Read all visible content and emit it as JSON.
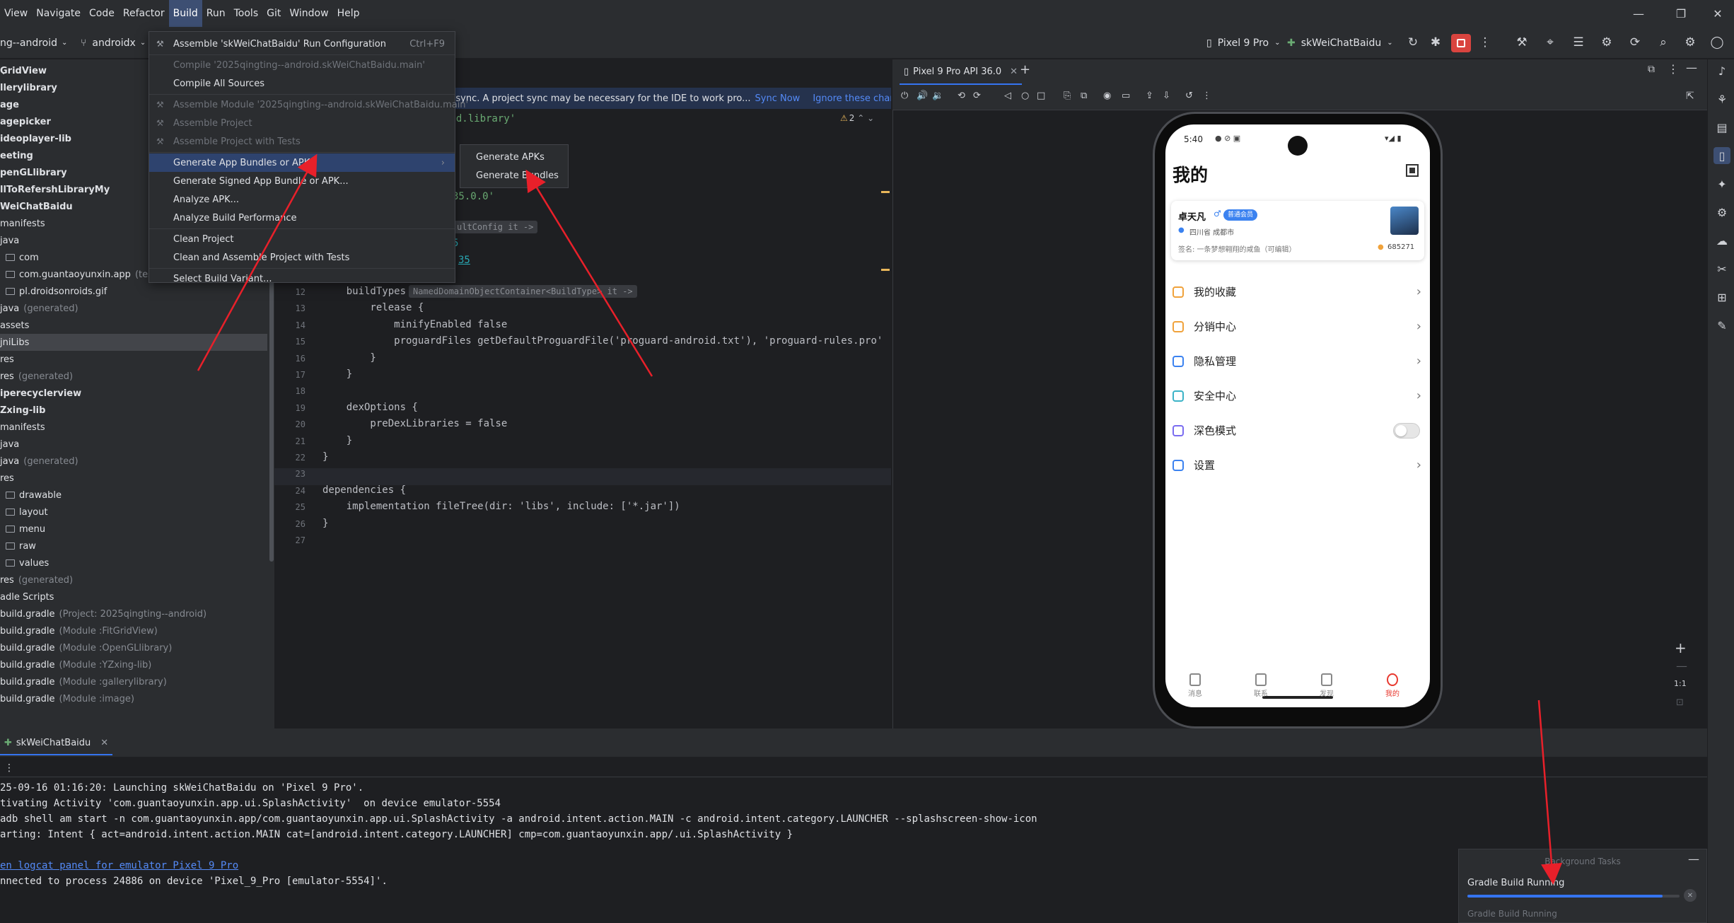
{
  "menubar": {
    "items": [
      "View",
      "Navigate",
      "Code",
      "Refactor",
      "Build",
      "Run",
      "Tools",
      "Git",
      "Window",
      "Help"
    ],
    "active": "Build"
  },
  "toolbar": {
    "project_name": "ng--android",
    "branch": "androidx",
    "device": "Pixel 9 Pro",
    "run_config": "skWeiChatBaidu"
  },
  "tree": {
    "items": [
      {
        "label": "GridView",
        "bold": true,
        "hint": "",
        "indent": 0
      },
      {
        "label": "llerylibrary",
        "bold": true,
        "hint": "",
        "indent": 0
      },
      {
        "label": "age",
        "bold": true,
        "hint": "",
        "indent": 0
      },
      {
        "label": "agepicker",
        "bold": true,
        "hint": "",
        "indent": 0
      },
      {
        "label": "ideoplayer-lib",
        "bold": true,
        "hint": "",
        "indent": 0
      },
      {
        "label": "eeting",
        "bold": true,
        "hint": "",
        "indent": 0
      },
      {
        "label": "penGLlibrary",
        "bold": true,
        "hint": "",
        "indent": 0
      },
      {
        "label": "llToRefershLibraryMy",
        "bold": true,
        "hint": "",
        "indent": 0
      },
      {
        "label": "WeiChatBaidu",
        "bold": true,
        "hint": "",
        "indent": 0
      },
      {
        "label": "manifests",
        "bold": false,
        "hint": "",
        "indent": 0
      },
      {
        "label": "java",
        "bold": false,
        "hint": "",
        "indent": 0
      },
      {
        "label": "com",
        "bold": false,
        "hint": "",
        "indent": 1
      },
      {
        "label": "com.guantaoyunxin.app",
        "bold": false,
        "hint": "(test)",
        "indent": 1
      },
      {
        "label": "pl.droidsonroids.gif",
        "bold": false,
        "hint": "",
        "indent": 1
      },
      {
        "label": "java",
        "bold": false,
        "hint": "(generated)",
        "indent": 0
      },
      {
        "label": "assets",
        "bold": false,
        "hint": "",
        "indent": 0
      },
      {
        "label": "jniLibs",
        "bold": false,
        "hint": "",
        "indent": 0
      },
      {
        "label": "res",
        "bold": false,
        "hint": "",
        "indent": 0
      },
      {
        "label": "res",
        "bold": false,
        "hint": "(generated)",
        "indent": 0
      },
      {
        "label": "iperecyclerview",
        "bold": true,
        "hint": "",
        "indent": 0
      },
      {
        "label": "Zxing-lib",
        "bold": true,
        "hint": "",
        "indent": 0
      },
      {
        "label": "manifests",
        "bold": false,
        "hint": "",
        "indent": 0
      },
      {
        "label": "java",
        "bold": false,
        "hint": "",
        "indent": 0
      },
      {
        "label": "java",
        "bold": false,
        "hint": "(generated)",
        "indent": 0
      },
      {
        "label": "res",
        "bold": false,
        "hint": "",
        "indent": 0
      },
      {
        "label": "drawable",
        "bold": false,
        "hint": "",
        "indent": 1
      },
      {
        "label": "layout",
        "bold": false,
        "hint": "",
        "indent": 1
      },
      {
        "label": "menu",
        "bold": false,
        "hint": "",
        "indent": 1
      },
      {
        "label": "raw",
        "bold": false,
        "hint": "",
        "indent": 1
      },
      {
        "label": "values",
        "bold": false,
        "hint": "",
        "indent": 1
      },
      {
        "label": "res",
        "bold": false,
        "hint": "(generated)",
        "indent": 0
      },
      {
        "label": "adle Scripts",
        "bold": false,
        "hint": "",
        "indent": 0
      },
      {
        "label": "build.gradle",
        "bold": false,
        "hint": "(Project: 2025qingting--android)",
        "indent": 0
      },
      {
        "label": "build.gradle",
        "bold": false,
        "hint": "(Module :FitGridView)",
        "indent": 0
      },
      {
        "label": "build.gradle",
        "bold": false,
        "hint": "(Module :OpenGLlibrary)",
        "indent": 0
      },
      {
        "label": "build.gradle",
        "bold": false,
        "hint": "(Module :YZxing-lib)",
        "indent": 0
      },
      {
        "label": "build.gradle",
        "bold": false,
        "hint": "(Module :gallerylibrary)",
        "indent": 0
      },
      {
        "label": "build.gradle",
        "bold": false,
        "hint": "(Module :image)",
        "indent": 0
      }
    ]
  },
  "banner": {
    "text": "ect sync. A project sync may be necessary for the IDE to work pro...",
    "sync_now": "Sync Now",
    "ignore": "Ignore these changes"
  },
  "editor": {
    "warnings": "2",
    "fragments": {
      "plugin": "oid.library'",
      "version": "35.0.0'",
      "inlay_default": "ultConfig it ->",
      "n35": "35",
      "s5": "5"
    },
    "build_types_inlay": "NamedDomainObjectContainer<BuildType> it ->",
    "lines": [
      {
        "n": "12",
        "text": "    buildTypes {"
      },
      {
        "n": "13",
        "text": "        release {"
      },
      {
        "n": "14",
        "text": "            minifyEnabled false"
      },
      {
        "n": "15",
        "text": "            proguardFiles getDefaultProguardFile('proguard-android.txt'), 'proguard-rules.pro'"
      },
      {
        "n": "16",
        "text": "        }"
      },
      {
        "n": "17",
        "text": "    }"
      },
      {
        "n": "18",
        "text": ""
      },
      {
        "n": "19",
        "text": "    dexOptions {"
      },
      {
        "n": "20",
        "text": "        preDexLibraries = false"
      },
      {
        "n": "21",
        "text": "    }"
      },
      {
        "n": "22",
        "text": "}"
      },
      {
        "n": "23",
        "text": ""
      },
      {
        "n": "24",
        "text": "dependencies {"
      },
      {
        "n": "25",
        "text": "    implementation fileTree(dir: 'libs', include: ['*.jar'])"
      },
      {
        "n": "26",
        "text": "}"
      },
      {
        "n": "27",
        "text": ""
      }
    ]
  },
  "build_menu": {
    "items": [
      {
        "label": "Assemble 'skWeiChatBaidu' Run Configuration",
        "shortcut": "Ctrl+F9",
        "disabled": false
      },
      {
        "label": "Compile '2025qingting--android.skWeiChatBaidu.main'",
        "shortcut": "",
        "disabled": true
      },
      {
        "label": "Compile All Sources",
        "shortcut": "",
        "disabled": false
      },
      {
        "label": "Assemble Module '2025qingting--android.skWeiChatBaidu.main'",
        "shortcut": "",
        "disabled": true
      },
      {
        "label": "Assemble Project",
        "shortcut": "",
        "disabled": true
      },
      {
        "label": "Assemble Project with Tests",
        "shortcut": "",
        "disabled": true
      },
      {
        "label": "Generate App Bundles or APKs",
        "shortcut": "",
        "disabled": false
      },
      {
        "label": "Generate Signed App Bundle or APK...",
        "shortcut": "",
        "disabled": false
      },
      {
        "label": "Analyze APK...",
        "shortcut": "",
        "disabled": false
      },
      {
        "label": "Analyze Build Performance",
        "shortcut": "",
        "disabled": false
      },
      {
        "label": "Clean Project",
        "shortcut": "",
        "disabled": false
      },
      {
        "label": "Clean and Assemble Project with Tests",
        "shortcut": "",
        "disabled": false
      },
      {
        "label": "Select Build Variant...",
        "shortcut": "",
        "disabled": false
      }
    ],
    "highlighted": "Generate App Bundles or APKs",
    "submenu": [
      "Generate APKs",
      "Generate Bundles"
    ]
  },
  "emulator": {
    "tab_title": "Pixel 9 Pro API 36.0",
    "zoom_label": "1:1"
  },
  "phone": {
    "status_time": "5:40",
    "title": "我的",
    "user_name": "卓天凡",
    "badge": "普通会员",
    "location": "四川省 成都市",
    "signature": "签名: 一条梦想翱翔的咸鱼（可编辑）",
    "coins": "685271",
    "menu": [
      {
        "label": "我的收藏",
        "color": "#f0a23b",
        "toggle": false
      },
      {
        "label": "分销中心",
        "color": "#f0a23b",
        "toggle": false
      },
      {
        "label": "隐私管理",
        "color": "#3b82f0",
        "toggle": false
      },
      {
        "label": "安全中心",
        "color": "#3bb3c7",
        "toggle": false
      },
      {
        "label": "深色模式",
        "color": "#7a6cf0",
        "toggle": true
      },
      {
        "label": "设置",
        "color": "#3b82f0",
        "toggle": false
      }
    ],
    "nav": [
      {
        "label": "消息",
        "active": false
      },
      {
        "label": "联系",
        "active": false
      },
      {
        "label": "发现",
        "active": false
      },
      {
        "label": "我的",
        "active": true
      }
    ]
  },
  "run_panel": {
    "tab": "skWeiChatBaidu",
    "log_lines": [
      "25-09-16 01:16:20: Launching skWeiChatBaidu on 'Pixel 9 Pro'.",
      "tivating Activity 'com.guantaoyunxin.app.ui.SplashActivity'  on device emulator-5554",
      "adb shell am start -n com.guantaoyunxin.app/com.guantaoyunxin.app.ui.SplashActivity -a android.intent.action.MAIN -c android.intent.category.LAUNCHER --splashscreen-show-icon",
      "arting: Intent { act=android.intent.action.MAIN cat=[android.intent.category.LAUNCHER] cmp=com.guantaoyunxin.app/.ui.SplashActivity }",
      "",
      "en logcat panel for emulator Pixel 9 Pro",
      "nnected to process 24886 on device 'Pixel_9_Pro [emulator-5554]'."
    ]
  },
  "background_tasks": {
    "title": "Background Tasks",
    "task": "Gradle Build Running",
    "task2": "Gradle Build Running",
    "progress": 0.92
  },
  "colors": {
    "accent": "#3574f0",
    "annotation_arrow": "#e8202a",
    "phone_active": "#e8392f"
  }
}
